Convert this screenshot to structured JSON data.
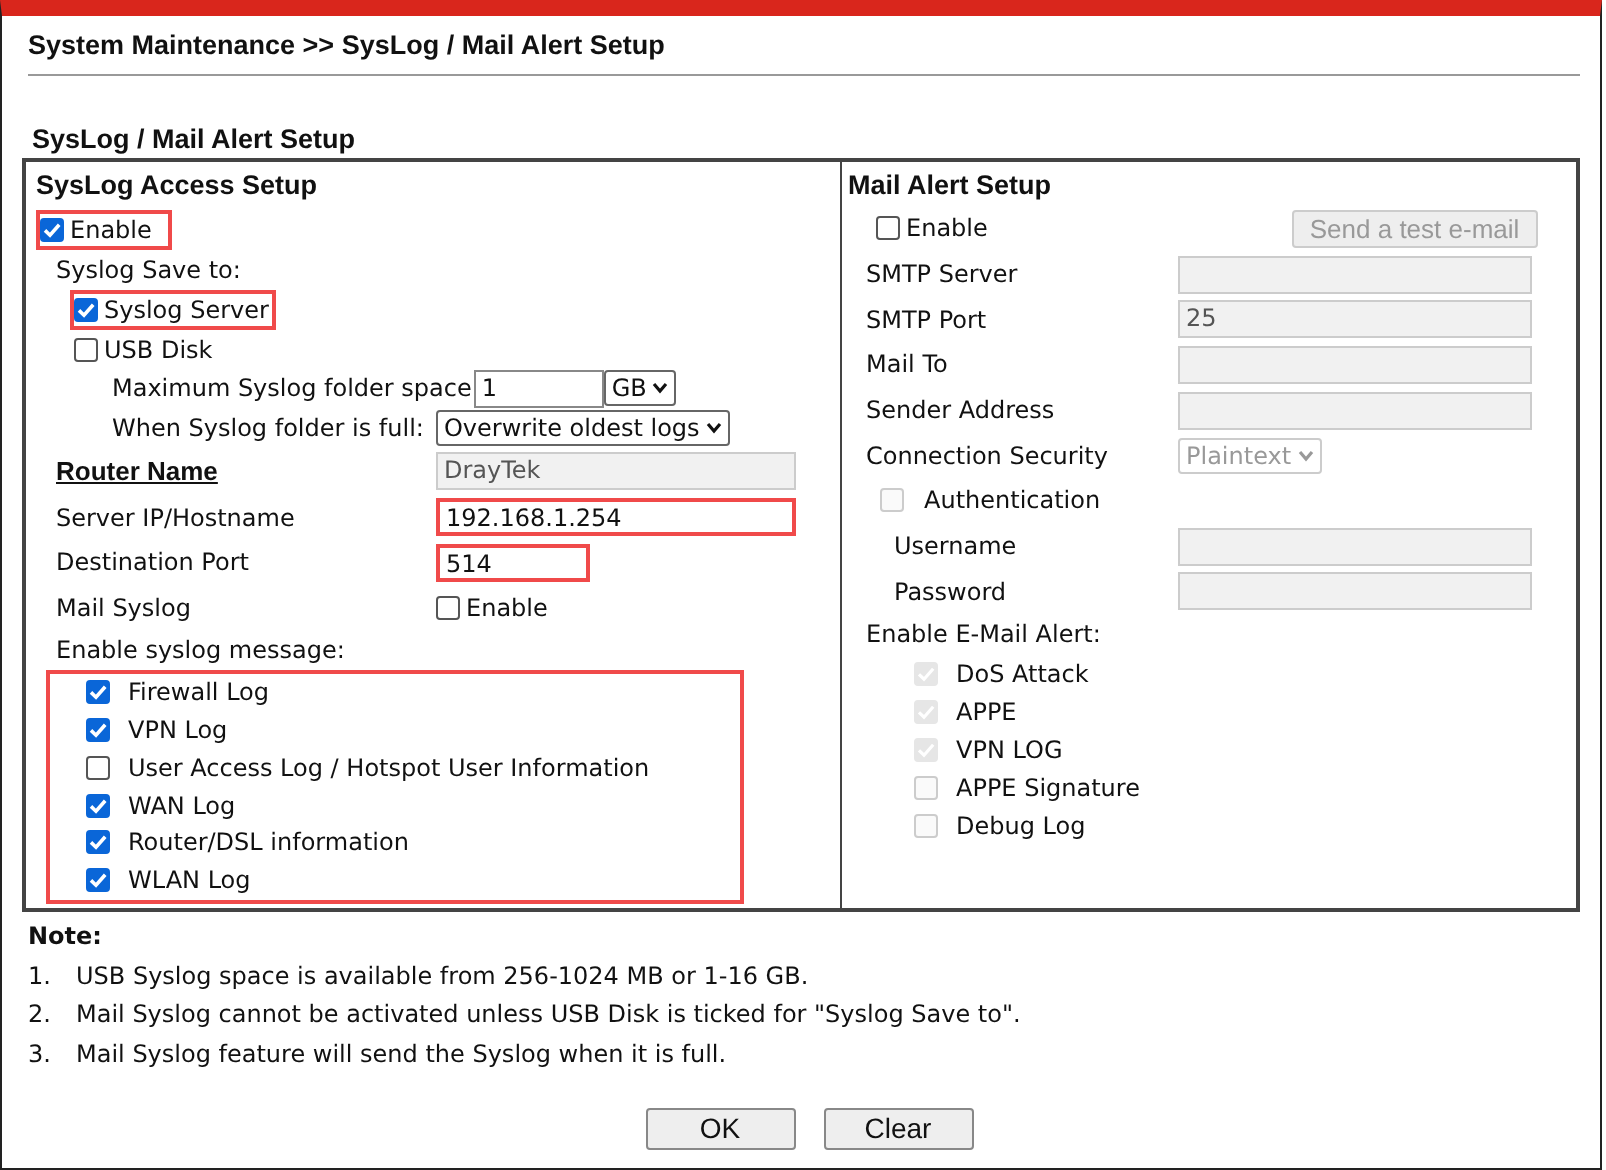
{
  "page_title": "System Maintenance >> SysLog / Mail Alert Setup",
  "section_title": "SysLog / Mail Alert Setup",
  "syslog": {
    "heading": "SysLog Access Setup",
    "enable": {
      "label": "Enable",
      "checked": true,
      "highlighted": true
    },
    "save_to_label": "Syslog Save to:",
    "save_to": [
      {
        "label": "Syslog Server",
        "checked": true,
        "highlighted": true
      },
      {
        "label": "USB Disk",
        "checked": false,
        "highlighted": false
      }
    ],
    "max_space": {
      "label": "Maximum Syslog folder space",
      "value": "1",
      "unit": "GB"
    },
    "when_full": {
      "label": "When Syslog folder is full:",
      "value": "Overwrite oldest logs"
    },
    "fields": [
      {
        "kind": "text",
        "label": "Router Name",
        "label_link": true,
        "value": "DrayTek",
        "disabled": true,
        "highlighted": false
      },
      {
        "kind": "text",
        "label": "Server IP/Hostname",
        "label_link": false,
        "value": "192.168.1.254",
        "disabled": false,
        "highlighted": true
      },
      {
        "kind": "short-text",
        "label": "Destination Port",
        "label_link": false,
        "value": "514",
        "disabled": false,
        "highlighted": true
      },
      {
        "kind": "checkbox",
        "label": "Mail Syslog",
        "label_link": false,
        "option": "Enable",
        "checked": false
      }
    ],
    "messages_label": "Enable syslog message:",
    "messages_highlighted": true,
    "messages": [
      {
        "label": "Firewall Log",
        "checked": true
      },
      {
        "label": "VPN Log",
        "checked": true
      },
      {
        "label": "User Access Log / Hotspot User Information",
        "checked": false
      },
      {
        "label": "WAN Log",
        "checked": true
      },
      {
        "label": "Router/DSL information",
        "checked": true
      },
      {
        "label": "WLAN Log",
        "checked": true
      }
    ]
  },
  "mail": {
    "heading": "Mail Alert Setup",
    "enable": {
      "label": "Enable",
      "checked": false
    },
    "test_button": {
      "label": "Send a test e-mail",
      "disabled": true
    },
    "fields": [
      {
        "kind": "text",
        "label": "SMTP Server",
        "disabled": true
      },
      {
        "kind": "text",
        "label": "SMTP Port",
        "value": "25",
        "disabled": true
      },
      {
        "kind": "text",
        "label": "Mail To",
        "disabled": true
      },
      {
        "kind": "text",
        "label": "Sender Address",
        "disabled": true
      },
      {
        "kind": "select",
        "label": "Connection Security",
        "value": "Plaintext",
        "disabled": true
      }
    ],
    "authentication": {
      "label": "Authentication",
      "checked": false,
      "disabled": true,
      "fields": [
        {
          "kind": "text",
          "label": "Username",
          "disabled": true
        },
        {
          "kind": "text",
          "label": "Password",
          "disabled": true
        }
      ]
    },
    "alerts_label": "Enable E-Mail Alert:",
    "alerts": [
      {
        "label": "DoS Attack",
        "checked": true,
        "disabled": true
      },
      {
        "label": "APPE",
        "checked": true,
        "disabled": true
      },
      {
        "label": "VPN LOG",
        "checked": true,
        "disabled": true
      },
      {
        "label": "APPE Signature",
        "checked": false,
        "disabled": true
      },
      {
        "label": "Debug Log",
        "checked": false,
        "disabled": true
      }
    ]
  },
  "note_label": "Note:",
  "notes": [
    {
      "number": "1.",
      "text": "USB Syslog space is available from 256-1024 MB or 1-16 GB."
    },
    {
      "number": "2.",
      "text": "Mail Syslog cannot be activated unless USB Disk is ticked for \"Syslog Save to\"."
    },
    {
      "number": "3.",
      "text": "Mail Syslog feature will send the Syslog when it is full."
    }
  ],
  "buttons": [
    "OK",
    "Clear"
  ]
}
